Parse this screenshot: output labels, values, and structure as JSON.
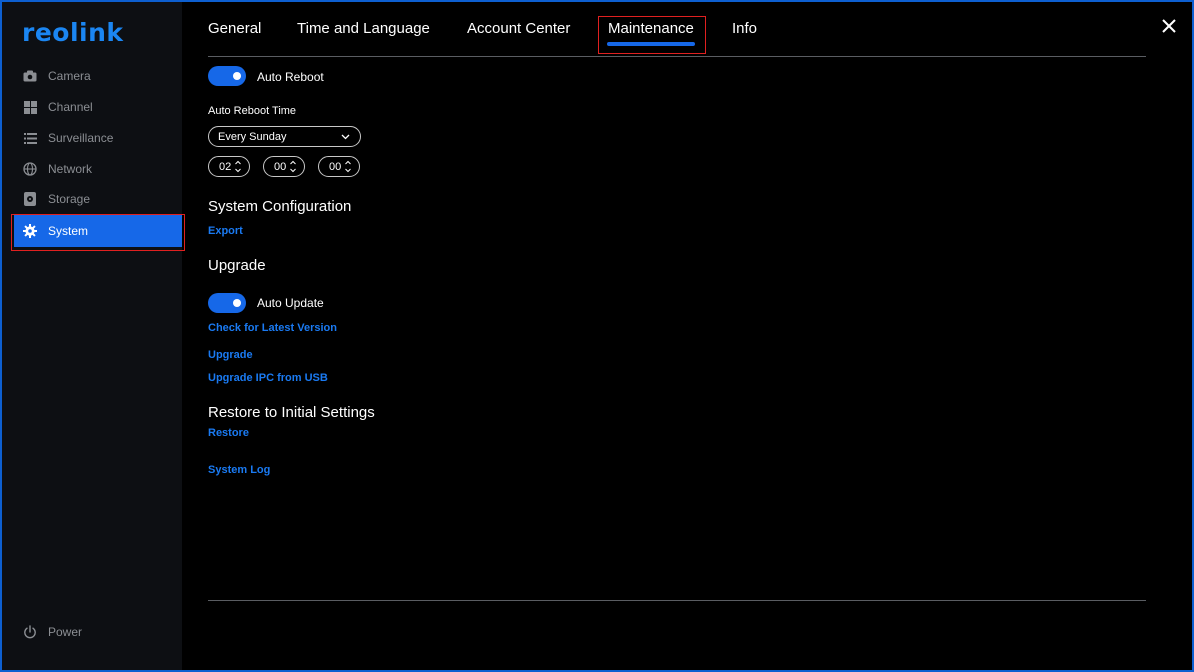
{
  "brand": {
    "logo_text": "reolink",
    "accent": "#1668e8",
    "link_color": "#1a7af2"
  },
  "sidebar": {
    "items": [
      {
        "label": "Camera",
        "icon": "camera-icon"
      },
      {
        "label": "Channel",
        "icon": "channel-grid-icon"
      },
      {
        "label": "Surveillance",
        "icon": "list-icon"
      },
      {
        "label": "Network",
        "icon": "globe-icon"
      },
      {
        "label": "Storage",
        "icon": "storage-icon"
      },
      {
        "label": "System",
        "icon": "gear-icon",
        "active": true
      }
    ],
    "power_label": "Power"
  },
  "tabs": [
    {
      "label": "General"
    },
    {
      "label": "Time and Language"
    },
    {
      "label": "Account Center"
    },
    {
      "label": "Maintenance",
      "active": true
    },
    {
      "label": "Info"
    }
  ],
  "maintenance": {
    "auto_reboot": {
      "label": "Auto Reboot",
      "enabled": true
    },
    "auto_reboot_time_label": "Auto Reboot Time",
    "reboot_day": "Every Sunday",
    "time": {
      "hour": "02",
      "minute": "00",
      "second": "00"
    },
    "system_configuration": {
      "title": "System Configuration",
      "export_label": "Export"
    },
    "upgrade": {
      "title": "Upgrade",
      "auto_update": {
        "label": "Auto Update",
        "enabled": true
      },
      "check_latest_label": "Check for Latest Version",
      "upgrade_label": "Upgrade",
      "upgrade_ipc_label": "Upgrade IPC from USB"
    },
    "restore": {
      "title": "Restore to Initial Settings",
      "restore_label": "Restore"
    },
    "system_log_label": "System Log"
  }
}
